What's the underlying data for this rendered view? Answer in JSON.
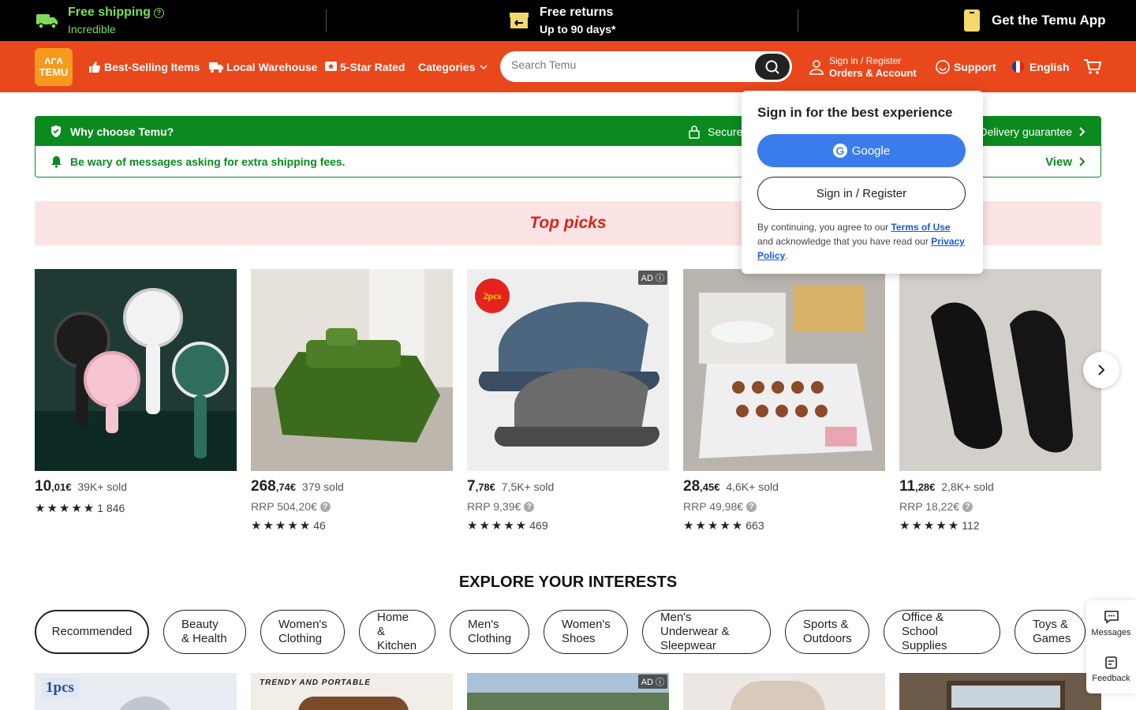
{
  "topbar": {
    "shipping_title": "Free shipping",
    "shipping_sub": "Incredible",
    "returns_title": "Free returns",
    "returns_sub": "Up to 90 days*",
    "app": "Get the Temu App"
  },
  "nav": {
    "logo_line1": "ᐱᒋᐱ",
    "logo_line2": "TEMU",
    "items": [
      "Best-Selling Items",
      "Local Warehouse",
      "5-Star Rated",
      "Categories"
    ],
    "search_placeholder": "Search Temu",
    "signin_line1": "Sign in / Register",
    "signin_line2": "Orders & Account",
    "support": "Support",
    "language": "English"
  },
  "why": {
    "title": "Why choose Temu?",
    "secure": "Secure",
    "delivery": "Delivery guarantee",
    "warning": "Be wary of messages asking for extra shipping fees.",
    "view": "View"
  },
  "top_picks": "Top picks",
  "products": [
    {
      "int": "10",
      "dec": ",01€",
      "sold": "39K+ sold",
      "rrp": "",
      "reviews": "1 846",
      "ad": false,
      "bg": "#1f3a34"
    },
    {
      "int": "268",
      "dec": ",74€",
      "sold": "379 sold",
      "rrp": "RRP 504,20€",
      "reviews": "46",
      "ad": false,
      "bg": "#d8d2ca"
    },
    {
      "int": "7",
      "dec": ",78€",
      "sold": "7,5K+ sold",
      "rrp": "RRP 9,39€",
      "reviews": "469",
      "ad": true,
      "bg": "#eeeeee"
    },
    {
      "int": "28",
      "dec": ",45€",
      "sold": "4,6K+ sold",
      "rrp": "RRP 49,98€",
      "reviews": "663",
      "ad": false,
      "bg": "#c9c6c0"
    },
    {
      "int": "11",
      "dec": ",28€",
      "sold": "2,8K+ sold",
      "rrp": "RRP 18,22€",
      "reviews": "112",
      "ad": false,
      "bg": "#d6d2cd"
    }
  ],
  "ad_label": "AD",
  "explore_title": "EXPLORE YOUR INTERESTS",
  "chips": [
    "Recommended",
    "Beauty & Health",
    "Women's Clothing",
    "Home & Kitchen",
    "Men's Clothing",
    "Women's Shoes",
    "Men's Underwear & Sleepwear",
    "Sports & Outdoors",
    "Office & School Supplies",
    "Toys & Games"
  ],
  "bottom_cards": [
    {
      "label": "1pcs"
    },
    {
      "label": "TRENDY AND PORTABLE"
    },
    {
      "label": ""
    },
    {
      "label": ""
    },
    {
      "label": ""
    }
  ],
  "side": {
    "messages": "Messages",
    "feedback": "Feedback"
  },
  "popup": {
    "title": "Sign in for the best experience",
    "google": "Google",
    "signin": "Sign in / Register",
    "legal1": "By continuing, you agree to our ",
    "terms": "Terms of Use",
    "legal2": " and acknowledge that you have read our ",
    "privacy": "Privacy Policy",
    "legal3": "."
  },
  "colors": {
    "brand": "#e8481c",
    "green": "#0a8a1f",
    "google_blue": "#3b7ced"
  }
}
